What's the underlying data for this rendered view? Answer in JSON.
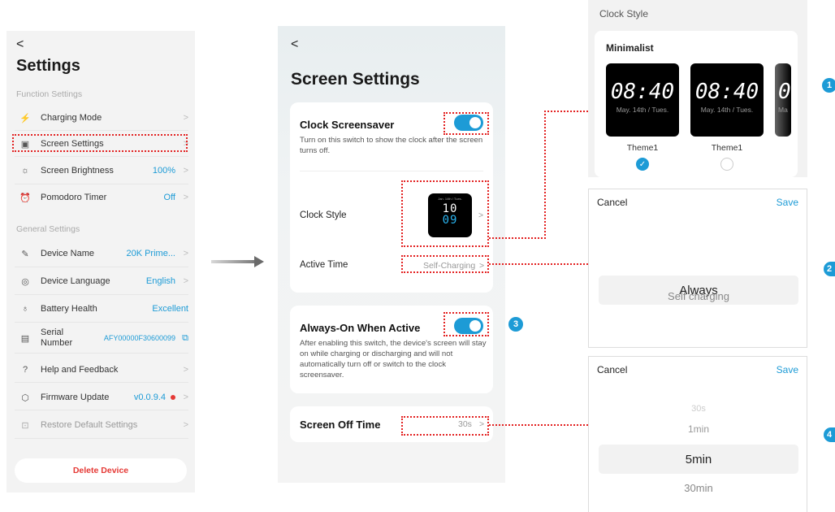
{
  "settings": {
    "back": "<",
    "title": "Settings",
    "function_section": "Function Settings",
    "general_section": "General Settings",
    "items": [
      {
        "icon": "⚡",
        "label": "Charging Mode",
        "value": "",
        "chev": ">"
      },
      {
        "icon": "▣",
        "label": "Screen Settings",
        "value": "",
        "chev": ">"
      },
      {
        "icon": "☼",
        "label": "Screen Brightness",
        "value": "100%",
        "chev": ">"
      },
      {
        "icon": "⏰",
        "label": "Pomodoro Timer",
        "value": "Off",
        "chev": ">"
      }
    ],
    "general_items": [
      {
        "icon": "✎",
        "label": "Device Name",
        "value": "20K Prime...",
        "chev": ">"
      },
      {
        "icon": "◎",
        "label": "Device Language",
        "value": "English",
        "chev": ">"
      },
      {
        "icon": "♁",
        "label": "Battery Health",
        "value": "Excellent",
        "chev": ""
      },
      {
        "icon": "▤",
        "label": "Serial Number",
        "value": "AFY00000F30600099",
        "chev": "⧉"
      },
      {
        "icon": "?",
        "label": "Help and Feedback",
        "value": "",
        "chev": ">"
      },
      {
        "icon": "⬡",
        "label": "Firmware Update",
        "value": "v0.0.9.4",
        "chev": ">"
      },
      {
        "icon": "⊡",
        "label": "Restore Default Settings",
        "value": "",
        "chev": ">"
      }
    ],
    "delete": "Delete Device"
  },
  "screen": {
    "back": "<",
    "title": "Screen Settings",
    "clock_screensaver": "Clock Screensaver",
    "clock_screensaver_desc": "Turn on this switch to show the clock after the screen turns off.",
    "clock_style": "Clock Style",
    "mini_clock": {
      "date": "Jan. 14th / Tues.",
      "hh": "10",
      "mm": "09"
    },
    "active_time": "Active Time",
    "active_time_value": "Self-Charging",
    "always_on": "Always-On When Active",
    "always_on_desc": "After enabling this switch, the device's screen will stay on while charging or discharging and will not automatically turn off or switch to the clock screensaver.",
    "screen_off": "Screen Off Time",
    "screen_off_value": "30s",
    "chev": ">"
  },
  "clock_style_panel": {
    "title": "Clock Style",
    "group": "Minimalist",
    "themes": [
      {
        "time": "08:40",
        "date": "May. 14th / Tues.",
        "label": "Theme1"
      },
      {
        "time": "08:40",
        "date": "May. 14th / Tues.",
        "label": "Theme1"
      },
      {
        "time": "0",
        "date": "Ma",
        "label": ""
      }
    ],
    "check": "✓"
  },
  "active_picker": {
    "cancel": "Cancel",
    "save": "Save",
    "selected": "Always",
    "options": [
      "Self charging"
    ]
  },
  "off_picker": {
    "cancel": "Cancel",
    "save": "Save",
    "options_above": [
      "30s",
      "1min"
    ],
    "selected": "5min",
    "options_below": [
      "30min"
    ]
  },
  "badges": {
    "b1": "1",
    "b2": "2",
    "b3": "3",
    "b4": "4"
  },
  "colors": {
    "accent": "#1d9bd6",
    "highlight": "#e32222"
  }
}
